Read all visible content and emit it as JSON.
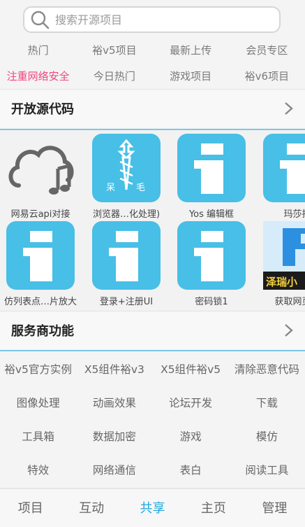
{
  "search": {
    "placeholder": "搜索开源项目"
  },
  "tags_row1": [
    "热门",
    "裕v5项目",
    "最新上传",
    "会员专区"
  ],
  "tags_row2": [
    "注重网络安全",
    "今日热门",
    "游戏项目",
    "裕v6项目"
  ],
  "section_open_source": {
    "title": "开放源代码"
  },
  "apps": [
    {
      "label": "网易云api对接",
      "icon": "cloud-music-icon"
    },
    {
      "label": "浏览器…化处理)",
      "icon": "browser-logo-icon",
      "tile_text_left": "呆",
      "tile_text_right": "毛"
    },
    {
      "label": "Yos 编辑框",
      "icon": "info-i-icon"
    },
    {
      "label": "玛莎拉",
      "icon": "info-i-icon"
    },
    {
      "label": "仿列表点…片放大",
      "icon": "info-i-icon"
    },
    {
      "label": "登录+注册UI",
      "icon": "info-i-icon"
    },
    {
      "label": "密码锁1",
      "icon": "info-i-icon"
    },
    {
      "label": "获取网页…",
      "icon": "thumbnail-image-icon",
      "tile_text": "泽瑞小"
    }
  ],
  "section_services": {
    "title": "服务商功能"
  },
  "categories": [
    [
      "裕v5官方实例",
      "X5组件裕v3",
      "X5组件裕v5",
      "清除恶意代码"
    ],
    [
      "图像处理",
      "动画效果",
      "论坛开发",
      "下载"
    ],
    [
      "工具箱",
      "数据加密",
      "游戏",
      "模仿"
    ],
    [
      "特效",
      "网络通信",
      "表白",
      "阅读工具"
    ]
  ],
  "tabs": [
    {
      "label": "项目",
      "active": false
    },
    {
      "label": "互动",
      "active": false
    },
    {
      "label": "共享",
      "active": true
    },
    {
      "label": "主页",
      "active": false
    },
    {
      "label": "管理",
      "active": false
    }
  ],
  "colors": {
    "accent": "#1aa7de",
    "tile": "#47bfe6",
    "hot": "#f2457f"
  }
}
